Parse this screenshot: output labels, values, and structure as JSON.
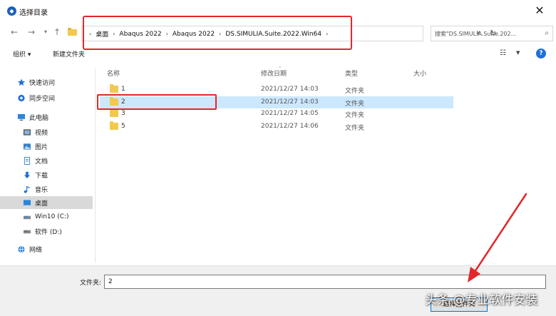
{
  "window": {
    "title": "选择目录"
  },
  "nav": {
    "crumbs": [
      "桌面",
      "Abaqus 2022",
      "Abaqus 2022",
      "DS.SIMULIA.Suite.2022.Win64"
    ],
    "search_placeholder": "搜索\"DS.SIMULIA.Suite.202..."
  },
  "toolbar": {
    "organize": "组织 ▾",
    "new_folder": "新建文件夹"
  },
  "sidebar": {
    "items": [
      {
        "label": "快速访问",
        "icon": "star-icon"
      },
      {
        "label": "同步空间",
        "icon": "cloud-icon"
      },
      {
        "label": "此电脑",
        "icon": "computer-icon"
      },
      {
        "label": "视频",
        "icon": "video-icon"
      },
      {
        "label": "图片",
        "icon": "picture-icon"
      },
      {
        "label": "文档",
        "icon": "document-icon"
      },
      {
        "label": "下载",
        "icon": "download-icon"
      },
      {
        "label": "音乐",
        "icon": "music-icon"
      },
      {
        "label": "桌面",
        "icon": "desktop-icon"
      },
      {
        "label": "Win10 (C:)",
        "icon": "drive-icon"
      },
      {
        "label": "软件 (D:)",
        "icon": "drive-icon"
      },
      {
        "label": "网络",
        "icon": "network-icon"
      }
    ]
  },
  "columns": {
    "name": "名称",
    "date": "修改日期",
    "type": "类型",
    "size": "大小"
  },
  "files": [
    {
      "name": "1",
      "date": "2021/12/27 14:03",
      "type": "文件夹"
    },
    {
      "name": "2",
      "date": "2021/12/27 14:03",
      "type": "文件夹"
    },
    {
      "name": "3",
      "date": "2021/12/27 14:05",
      "type": "文件夹"
    },
    {
      "name": "5",
      "date": "2021/12/27 14:06",
      "type": "文件夹"
    }
  ],
  "footer": {
    "folder_label": "文件夹:",
    "folder_value": "2",
    "select_label": "选择文件夹"
  },
  "watermark": "头条 @专业软件安装",
  "colors": {
    "accent": "#0078d7",
    "selection": "#cce8ff",
    "highlight": "#e2272a",
    "folder": "#f2c94c"
  }
}
